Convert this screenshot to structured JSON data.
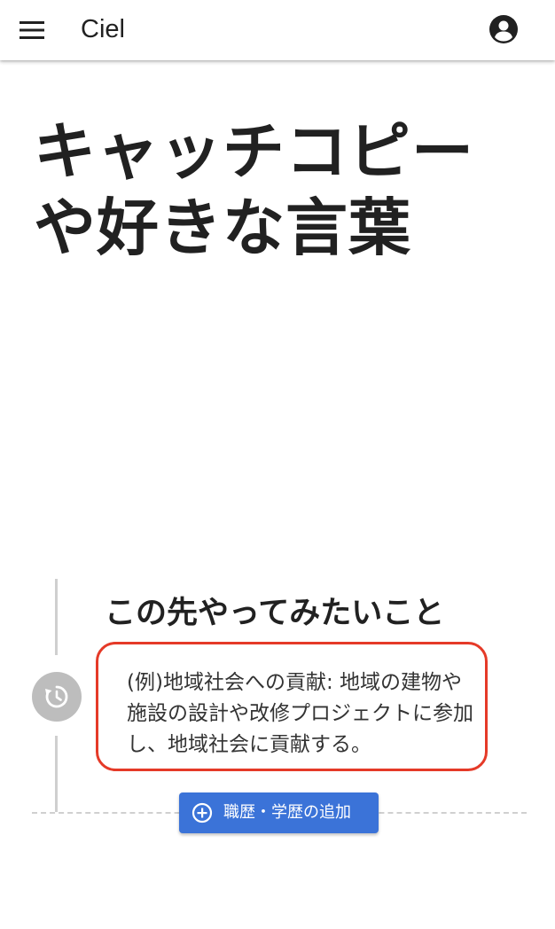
{
  "app": {
    "title": "Ciel"
  },
  "hero": {
    "catchphrase_line1": "キャッチコピー",
    "catchphrase_line2": "や好きな言葉"
  },
  "future_section": {
    "heading": "この先やってみたいこと",
    "example_text": "(例)地域社会への貢献: 地域の建物や施設の設計や改修プロジェクトに参加し、地域社会に貢献する。"
  },
  "actions": {
    "add_career_label": "職歴・学歴の追加"
  },
  "colors": {
    "accent_button": "#3b73d8",
    "highlight_border": "#e53a28",
    "timeline_gray": "#bdbdbd"
  },
  "icons": {
    "menu": "menu-icon",
    "account": "account-circle-icon",
    "timeline_node": "history-icon",
    "add": "add-circle-icon"
  }
}
